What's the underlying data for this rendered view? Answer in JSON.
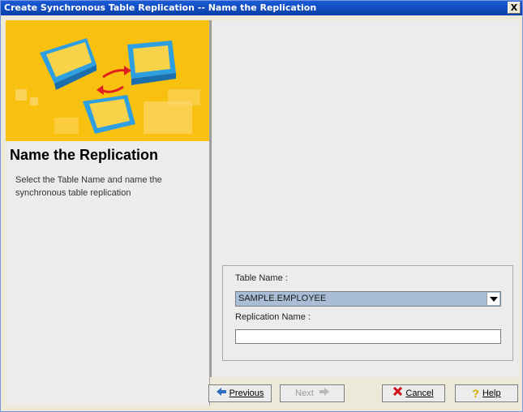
{
  "window": {
    "title": "Create Synchronous Table Replication -- Name the Replication",
    "close_glyph": "X"
  },
  "left": {
    "heading": "Name the Replication",
    "description": "Select the Table Name and name the synchronous table replication"
  },
  "form": {
    "table_name_label": "Table Name :",
    "table_name_value": "SAMPLE.EMPLOYEE",
    "replication_name_label": "Replication Name :",
    "replication_name_value": ""
  },
  "buttons": {
    "previous": "Previous",
    "next": "Next",
    "cancel": "Cancel",
    "help": "Help"
  },
  "icons": {
    "previous": "left-arrow-icon",
    "next": "right-arrow-icon",
    "cancel": "red-x-icon",
    "help": "question-mark-icon"
  },
  "colors": {
    "title_bar": "#0a3ea9",
    "hero_bg": "#f9c10f",
    "combo_selected": "#a9bdd6"
  }
}
